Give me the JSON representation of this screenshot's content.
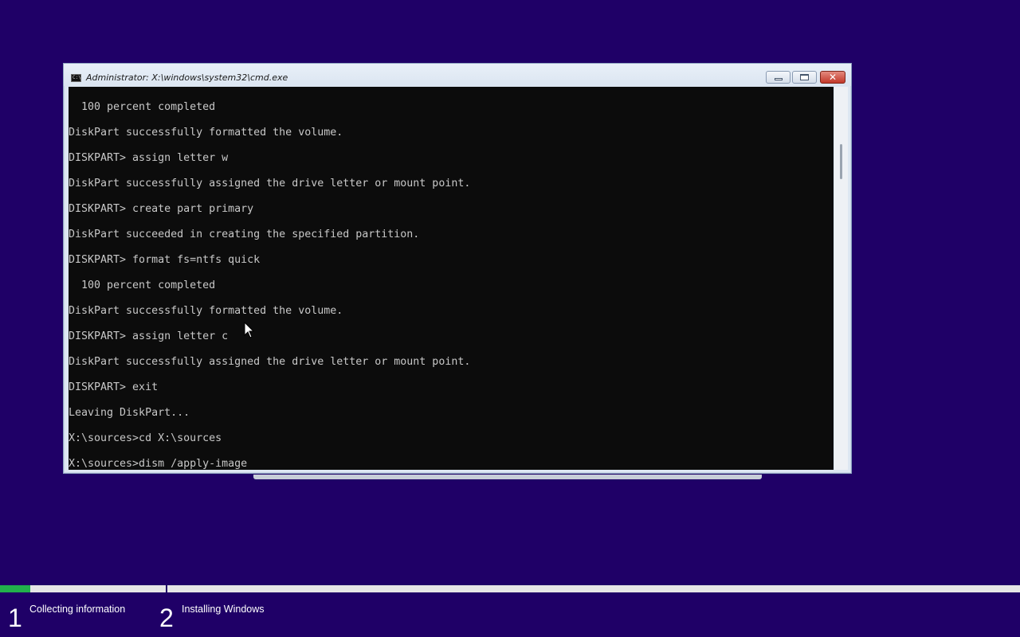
{
  "window": {
    "title": "Administrator: X:\\windows\\system32\\cmd.exe",
    "icon_text": "C:\\",
    "close_glyph": "✕"
  },
  "console": {
    "lines": [
      "  100 percent completed",
      "DiskPart successfully formatted the volume.",
      "DISKPART> assign letter w",
      "DiskPart successfully assigned the drive letter or mount point.",
      "DISKPART> create part primary",
      "DiskPart succeeded in creating the specified partition.",
      "DISKPART> format fs=ntfs quick",
      "  100 percent completed",
      "DiskPart successfully formatted the volume.",
      "DISKPART> assign letter c",
      "DiskPart successfully assigned the drive letter or mount point.",
      "DISKPART> exit",
      "Leaving DiskPart...",
      "X:\\sources>cd X:\\sources",
      "X:\\sources>dism /apply-image"
    ]
  },
  "setup": {
    "progress_fraction": 0.03,
    "colors": {
      "background": "#1f0067",
      "progress": "#22b14c"
    },
    "steps": [
      {
        "number": "1",
        "label": "Collecting information"
      },
      {
        "number": "2",
        "label": "Installing Windows"
      }
    ]
  }
}
